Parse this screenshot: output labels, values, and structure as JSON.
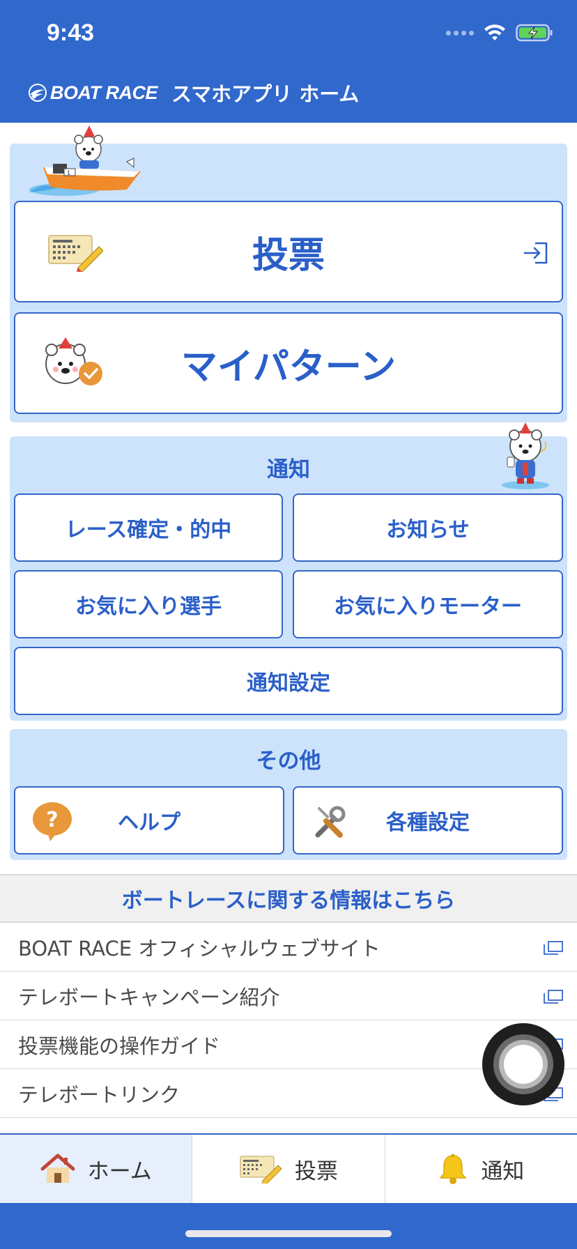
{
  "status_bar": {
    "time": "9:43"
  },
  "header": {
    "brand": "BOAT RACE",
    "title": "スマホアプリ ホーム"
  },
  "vote_panel": {
    "vote_label": "投票",
    "my_pattern_label": "マイパターン"
  },
  "notify_panel": {
    "title": "通知",
    "race_result_label": "レース確定・的中",
    "news_label": "お知らせ",
    "favorite_racer_label": "お気に入り選手",
    "favorite_motor_label": "お気に入りモーター",
    "notify_settings_label": "通知設定"
  },
  "other_panel": {
    "title": "その他",
    "help_label": "ヘルプ",
    "help_icon_glyph": "?",
    "settings_label": "各種設定"
  },
  "info_section": {
    "title": "ボートレースに関する情報はこちら",
    "links": [
      {
        "label": "BOAT RACE オフィシャルウェブサイト"
      },
      {
        "label": "テレボートキャンペーン紹介"
      },
      {
        "label": "投票機能の操作ガイド"
      },
      {
        "label": "テレボートリンク"
      }
    ]
  },
  "tabbar": {
    "items": [
      {
        "label": "ホーム",
        "icon": "house-icon",
        "active": true
      },
      {
        "label": "投票",
        "icon": "ticket-pen-icon",
        "active": false
      },
      {
        "label": "通知",
        "icon": "bell-icon",
        "active": false
      }
    ]
  },
  "colors": {
    "brand_blue": "#3068cc",
    "panel_bg": "#cce3fb",
    "text_blue": "#2a5fc9",
    "accent_orange": "#e8973a"
  }
}
